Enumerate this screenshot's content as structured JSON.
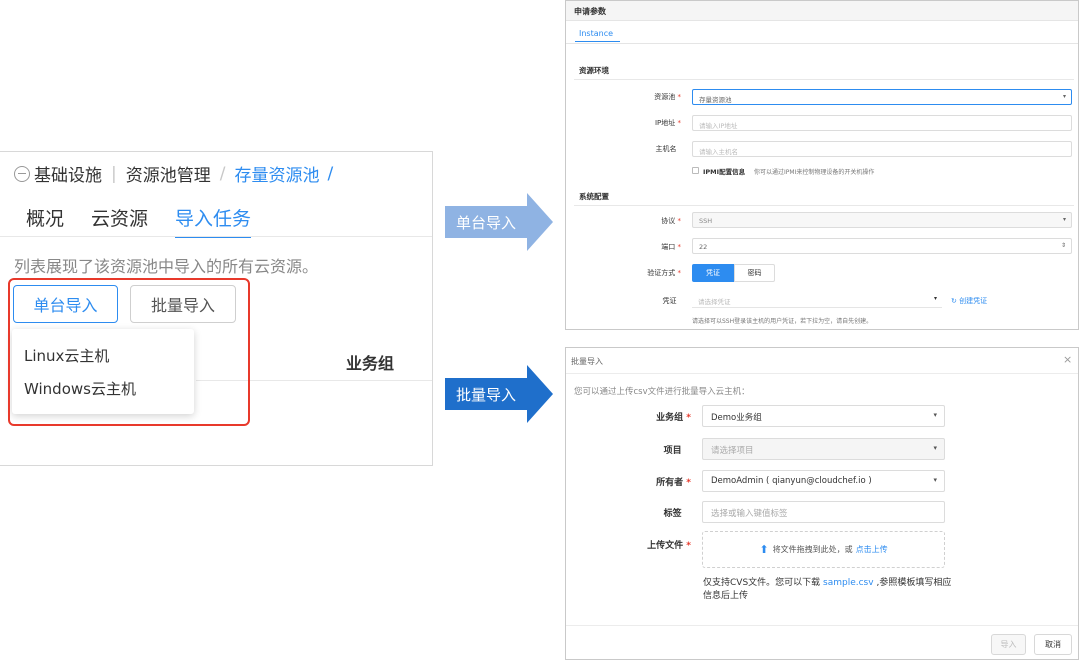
{
  "left": {
    "breadcrumb": {
      "root": "基础设施",
      "mid": "资源池管理",
      "current": "存量资源池",
      "sep": "/"
    },
    "tabs": [
      "概况",
      "云资源",
      "导入任务"
    ],
    "description": "列表展现了该资源池中导入的所有云资源。",
    "single_import": "单台导入",
    "batch_import": "批量导入",
    "dropdown": [
      "Linux云主机",
      "Windows云主机"
    ],
    "column_header": "业务组"
  },
  "arrows": {
    "top": "单台导入",
    "bottom": "批量导入"
  },
  "single_form": {
    "header": "申请参数",
    "tab": "Instance",
    "section_env": "资源环境",
    "pool_label": "资源池",
    "pool_value": "存量资源池",
    "ip_label": "IP地址",
    "ip_placeholder": "请输入IP地址",
    "host_label": "主机名",
    "host_placeholder": "请输入主机名",
    "ipmi_label": "IPMI配置信息",
    "ipmi_hint": "你可以通过IPMI来控制物理设备的开关机操作",
    "section_sys": "系统配置",
    "protocol_label": "协议",
    "protocol_value": "SSH",
    "port_label": "端口",
    "port_value": "22",
    "auth_label": "验证方式",
    "auth_cred": "凭证",
    "auth_pwd": "密码",
    "cred_label": "凭证",
    "cred_placeholder": "请选择凭证",
    "create_cred": "创建凭证",
    "cred_hint": "请选择可以SSH登录该主机的用户凭证，若下拉为空，请自先创建。"
  },
  "batch_modal": {
    "title": "批量导入",
    "close": "×",
    "note": "您可以通过上传csv文件进行批量导入云主机：",
    "group_label": "业务组",
    "group_value": "Demo业务组",
    "project_label": "项目",
    "project_placeholder": "请选择项目",
    "owner_label": "所有者",
    "owner_value": "DemoAdmin ( qianyun@cloudchef.io )",
    "tag_label": "标签",
    "tag_placeholder": "选择或输入键值标签",
    "upload_label": "上传文件",
    "upload_text": "将文件拖拽到此处，或",
    "upload_link": "点击上传",
    "help_prefix": "仅支持CVS文件。您可以下载",
    "help_link": "sample.csv",
    "help_suffix": ",参照模板填写相应信息后上传",
    "import_btn": "导入",
    "cancel_btn": "取消"
  },
  "colors": {
    "accent": "#2d8cf0",
    "danger": "#e8392b",
    "arrow_light": "#8fb3e3",
    "arrow_dark": "#1f6fcb"
  }
}
